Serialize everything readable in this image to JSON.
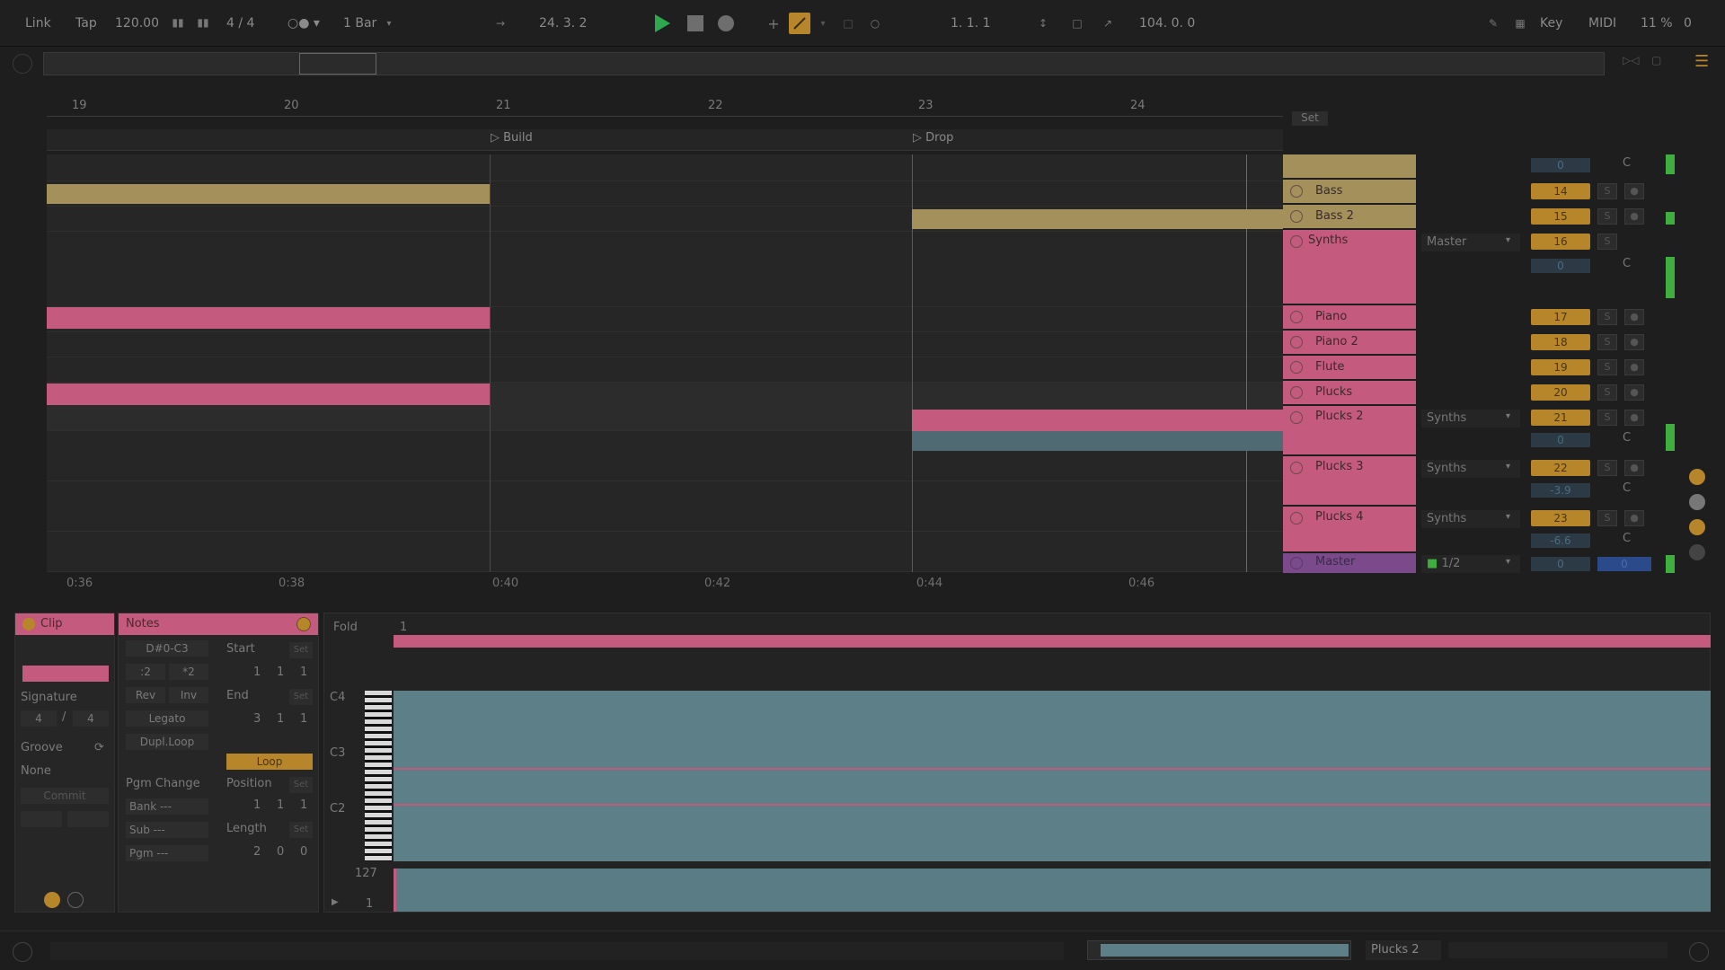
{
  "transport": {
    "link": "Link",
    "tap": "Tap",
    "tempo": "120.00",
    "signature": "4 / 4",
    "quantize": "1 Bar",
    "position": "24. 3. 2",
    "loop_start": "1. 1. 1",
    "loop_length": "104. 0. 0",
    "key": "Key",
    "midi": "MIDI",
    "cpu": "11 %",
    "overload": "0"
  },
  "ruler": {
    "bars": [
      "19",
      "20",
      "21",
      "22",
      "23",
      "24"
    ]
  },
  "locators": {
    "build": "Build",
    "drop": "Drop"
  },
  "timeline": {
    "times": [
      "0:36",
      "0:38",
      "0:40",
      "0:42",
      "0:44",
      "0:46"
    ]
  },
  "set_label": "Set",
  "tracks": [
    {
      "name": "Bass",
      "number": "14"
    },
    {
      "name": "Bass 2",
      "number": "15"
    },
    {
      "name": "Synths",
      "number": "16",
      "route": "Master",
      "volume": "0",
      "pan": "C"
    },
    {
      "name": "Piano",
      "number": "17"
    },
    {
      "name": "Piano 2",
      "number": "18"
    },
    {
      "name": "Flute",
      "number": "19"
    },
    {
      "name": "Plucks",
      "number": "20"
    },
    {
      "name": "Plucks 2",
      "number": "21",
      "route": "Synths",
      "volume": "0",
      "pan": "C"
    },
    {
      "name": "Plucks 3",
      "number": "22",
      "route": "Synths",
      "volume": "-3.9",
      "pan": "C"
    },
    {
      "name": "Plucks 4",
      "number": "23",
      "route": "Synths",
      "volume": "-6.6",
      "pan": "C"
    }
  ],
  "group_top": {
    "volume": "0",
    "pan": "C"
  },
  "master": {
    "name": "Master",
    "route": "1/2",
    "volume": "0",
    "pan": "0"
  },
  "clip_panel": {
    "title": "Clip",
    "signature_label": "Signature",
    "sig_num": "4",
    "sig_den": "4",
    "groove_label": "Groove",
    "groove_value": "None",
    "commit": "Commit"
  },
  "notes_panel": {
    "title": "Notes",
    "range": "D#0-C3",
    "div2": ":2",
    "mul2": "*2",
    "rev": "Rev",
    "inv": "Inv",
    "legato": "Legato",
    "dupl": "Dupl.Loop",
    "start_label": "Start",
    "start": [
      "1",
      "1",
      "1"
    ],
    "end_label": "End",
    "end": [
      "3",
      "1",
      "1"
    ],
    "loop": "Loop",
    "pgm_change": "Pgm Change",
    "position_label": "Position",
    "position": [
      "1",
      "1",
      "1"
    ],
    "bank": "Bank ---",
    "sub": "Sub ---",
    "pgm": "Pgm ---",
    "length_label": "Length",
    "length": [
      "2",
      "0",
      "0"
    ]
  },
  "editor": {
    "fold": "Fold",
    "ruler_start": "1",
    "keys": [
      "C4",
      "C3",
      "C2"
    ],
    "vel_max": "127",
    "vel_min": "1"
  },
  "status": {
    "selected_track": "Plucks 2"
  },
  "colors": {
    "pink": "#c45a7e",
    "gold": "#a3905b",
    "orange": "#b8862a",
    "play": "#2ea84f",
    "teal": "#5c7f88",
    "master": "#7a4a8a"
  }
}
